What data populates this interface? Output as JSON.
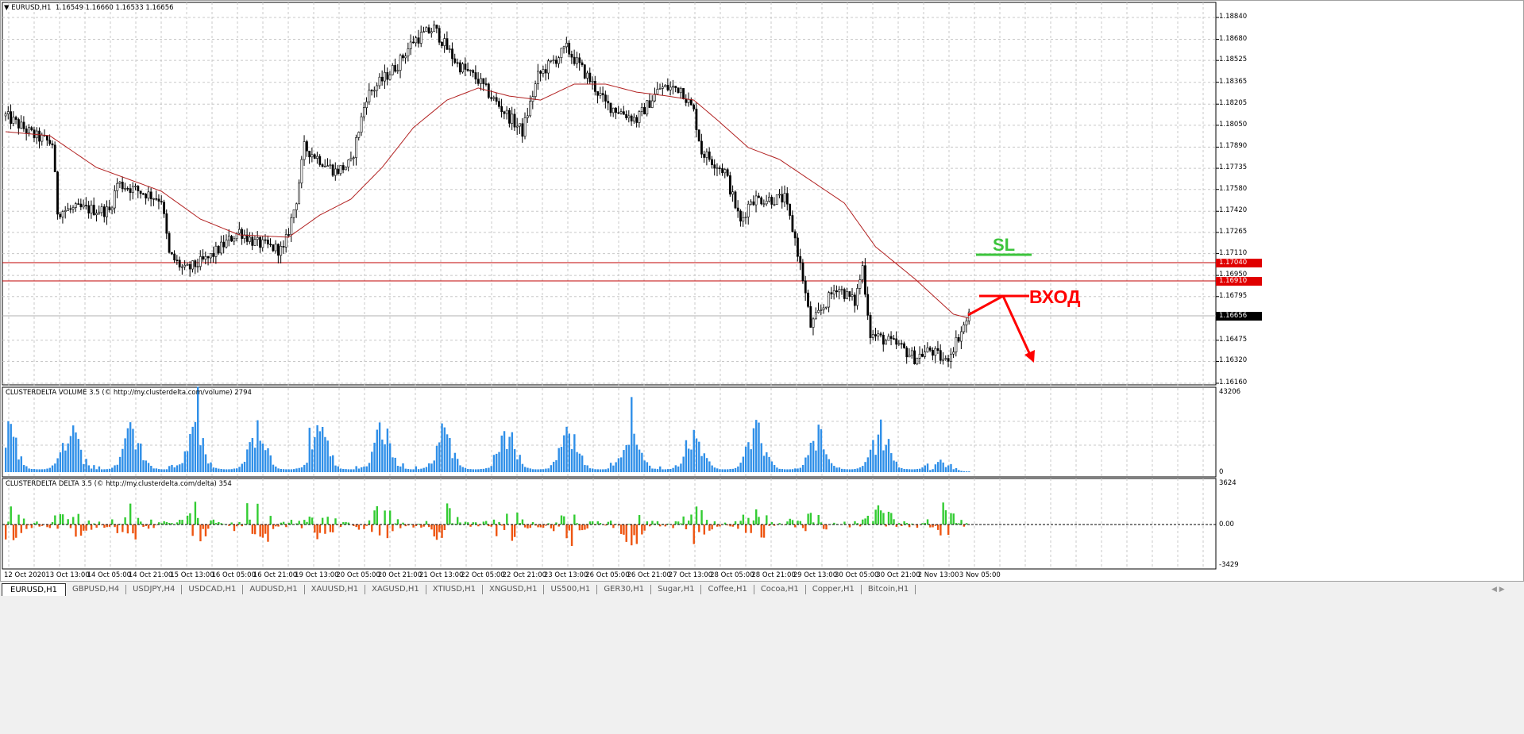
{
  "header": {
    "symbol": "EURUSD,H1",
    "ohlc": "1.16549 1.16660 1.16533 1.16656"
  },
  "price_axis": [
    "1.18840",
    "1.18680",
    "1.18525",
    "1.18365",
    "1.18205",
    "1.18050",
    "1.17890",
    "1.17735",
    "1.17580",
    "1.17420",
    "1.17265",
    "1.17110",
    "1.16950",
    "1.16795",
    "1.16475",
    "1.16320",
    "1.16160"
  ],
  "levels": {
    "upper": "1.17040",
    "lower": "1.16910",
    "current": "1.16656"
  },
  "annotations": {
    "sl": "SL",
    "entry": "ВХОД"
  },
  "colors": {
    "sl": "#3cc43c",
    "entry": "#ff0000",
    "level": "#c00000",
    "ma": "#b22222",
    "volume": "#2f8fe8",
    "delta_pos": "#33cc33",
    "delta_neg": "#ee5511"
  },
  "volume_panel": {
    "label": "CLUSTERDELTA VOLUME 3.5 (© http://my.clusterdelta.com/volume) 2794",
    "max": "43206",
    "min": "0"
  },
  "delta_panel": {
    "label": "CLUSTERDELTA DELTA 3.5 (© http://my.clusterdelta.com/delta) 354",
    "max": "3624",
    "zero": "0.00",
    "min": "-3429"
  },
  "time_axis": [
    "12 Oct 2020",
    "13 Oct 13:00",
    "14 Oct 05:00",
    "14 Oct 21:00",
    "15 Oct 13:00",
    "16 Oct 05:00",
    "16 Oct 21:00",
    "19 Oct 13:00",
    "20 Oct 05:00",
    "20 Oct 21:00",
    "21 Oct 13:00",
    "22 Oct 05:00",
    "22 Oct 21:00",
    "23 Oct 13:00",
    "26 Oct 05:00",
    "26 Oct 21:00",
    "27 Oct 13:00",
    "28 Oct 05:00",
    "28 Oct 21:00",
    "29 Oct 13:00",
    "30 Oct 05:00",
    "30 Oct 21:00",
    "2 Nov 13:00",
    "3 Nov 05:00"
  ],
  "tabs": [
    "EURUSD,H1",
    "GBPUSD,H4",
    "USDJPY,H4",
    "USDCAD,H1",
    "AUDUSD,H1",
    "XAUUSD,H1",
    "XAGUSD,H1",
    "XTIUSD,H1",
    "XNGUSD,H1",
    "US500,H1",
    "GER30,H1",
    "Sugar,H1",
    "Coffee,H1",
    "Cocoa,H1",
    "Copper,H1",
    "Bitcoin,H1"
  ],
  "chart_data": {
    "type": "candlestick",
    "bars": 372,
    "ylim": [
      1.1616,
      1.1884
    ],
    "close_path": [
      [
        0,
        1.18119
      ],
      [
        11,
        1.17974
      ],
      [
        18,
        1.17916
      ],
      [
        20,
        1.17421
      ],
      [
        29,
        1.17439
      ],
      [
        40,
        1.17421
      ],
      [
        43,
        1.17625
      ],
      [
        60,
        1.17509
      ],
      [
        63,
        1.17102
      ],
      [
        69,
        1.16986
      ],
      [
        78,
        1.17073
      ],
      [
        90,
        1.17276
      ],
      [
        96,
        1.17189
      ],
      [
        107,
        1.17131
      ],
      [
        112,
        1.17509
      ],
      [
        115,
        1.17887
      ],
      [
        127,
        1.17712
      ],
      [
        133,
        1.1777
      ],
      [
        139,
        1.18264
      ],
      [
        151,
        1.18497
      ],
      [
        157,
        1.18671
      ],
      [
        165,
        1.18759
      ],
      [
        174,
        1.18497
      ],
      [
        182,
        1.18381
      ],
      [
        188,
        1.18235
      ],
      [
        199,
        1.18003
      ],
      [
        205,
        1.1841
      ],
      [
        216,
        1.18613
      ],
      [
        225,
        1.18381
      ],
      [
        231,
        1.18206
      ],
      [
        243,
        1.1809
      ],
      [
        252,
        1.18323
      ],
      [
        260,
        1.18323
      ],
      [
        265,
        1.18148
      ],
      [
        268,
        1.17857
      ],
      [
        277,
        1.17712
      ],
      [
        283,
        1.17334
      ],
      [
        287,
        1.17509
      ],
      [
        300,
        1.17509
      ],
      [
        304,
        1.17218
      ],
      [
        307,
        1.16927
      ],
      [
        310,
        1.16579
      ],
      [
        320,
        1.16869
      ],
      [
        327,
        1.16753
      ],
      [
        330,
        1.17014
      ],
      [
        333,
        1.1652
      ],
      [
        344,
        1.16433
      ],
      [
        350,
        1.16346
      ],
      [
        356,
        1.16404
      ],
      [
        362,
        1.16317
      ],
      [
        371,
        1.16656
      ]
    ],
    "ma_path": [
      [
        0,
        1.18003
      ],
      [
        17,
        1.17974
      ],
      [
        35,
        1.17741
      ],
      [
        60,
        1.17567
      ],
      [
        75,
        1.17363
      ],
      [
        90,
        1.17247
      ],
      [
        109,
        1.1723
      ],
      [
        121,
        1.17392
      ],
      [
        133,
        1.17509
      ],
      [
        145,
        1.17741
      ],
      [
        157,
        1.18032
      ],
      [
        170,
        1.18235
      ],
      [
        182,
        1.18323
      ],
      [
        194,
        1.18264
      ],
      [
        206,
        1.18235
      ],
      [
        219,
        1.18352
      ],
      [
        231,
        1.18352
      ],
      [
        243,
        1.18293
      ],
      [
        255,
        1.18264
      ],
      [
        265,
        1.18235
      ],
      [
        274,
        1.1809
      ],
      [
        286,
        1.17887
      ],
      [
        298,
        1.178
      ],
      [
        323,
        1.1748
      ],
      [
        335,
        1.1716
      ],
      [
        350,
        1.16927
      ],
      [
        365,
        1.16666
      ],
      [
        371,
        1.16637
      ]
    ],
    "volume_range": [
      0,
      43206
    ],
    "delta_range": [
      -3429,
      3624
    ]
  }
}
